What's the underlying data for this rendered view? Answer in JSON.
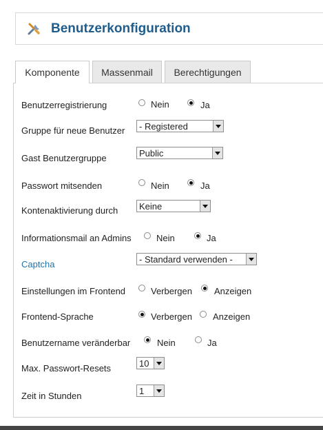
{
  "header": {
    "title": "Benutzerkonfiguration",
    "icon": "tools-icon"
  },
  "tabs": [
    {
      "label": "Komponente",
      "active": true
    },
    {
      "label": "Massenmail",
      "active": false
    },
    {
      "label": "Berechtigungen",
      "active": false
    }
  ],
  "form": {
    "registration": {
      "label": "Benutzerregistrierung",
      "opt1": "Nein",
      "opt2": "Ja",
      "selected": "Ja"
    },
    "new_user_group": {
      "label": "Gruppe für neue Benutzer",
      "value": "- Registered"
    },
    "guest_group": {
      "label": "Gast Benutzergruppe",
      "value": "Public"
    },
    "send_password": {
      "label": "Passwort mitsenden",
      "opt1": "Nein",
      "opt2": "Ja",
      "selected": "Ja"
    },
    "account_activation": {
      "label": "Kontenaktivierung durch",
      "value": "Keine"
    },
    "admin_mail": {
      "label": "Informationsmail an Admins",
      "opt1": "Nein",
      "opt2": "Ja",
      "selected": "Ja"
    },
    "captcha": {
      "label": "Captcha",
      "value": "- Standard verwenden -"
    },
    "frontend_settings": {
      "label": "Einstellungen im Frontend",
      "opt1": "Verbergen",
      "opt2": "Anzeigen",
      "selected": "Anzeigen"
    },
    "frontend_language": {
      "label": "Frontend-Sprache",
      "opt1": "Verbergen",
      "opt2": "Anzeigen",
      "selected": "Verbergen"
    },
    "username_changeable": {
      "label": "Benutzername veränderbar",
      "opt1": "Nein",
      "opt2": "Ja",
      "selected": "Nein"
    },
    "max_resets": {
      "label": "Max. Passwort-Resets",
      "value": "10"
    },
    "time_hours": {
      "label": "Zeit in Stunden",
      "value": "1"
    }
  }
}
